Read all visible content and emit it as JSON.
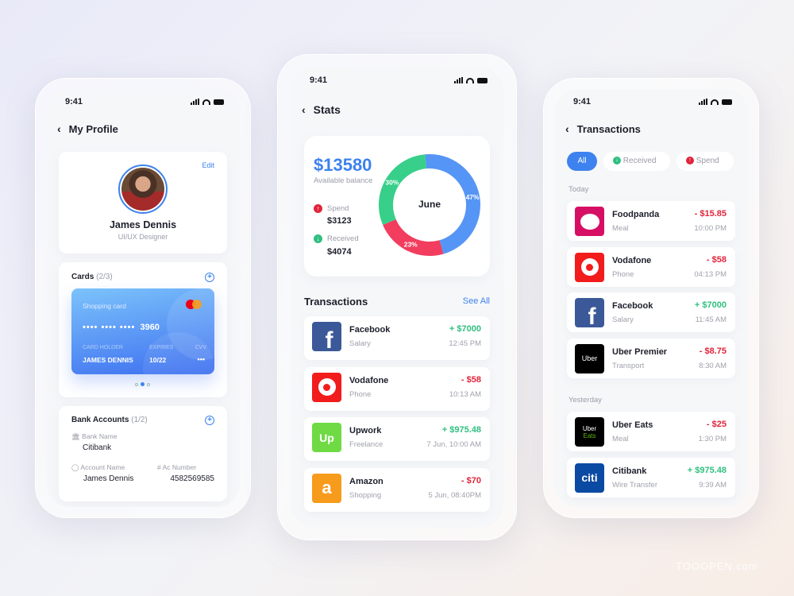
{
  "status_time": "9:41",
  "profile": {
    "title": "My Profile",
    "edit": "Edit",
    "name": "James Dennis",
    "role": "UI/UX Designer",
    "cards_title": "Cards",
    "cards_count": "(2/3)",
    "card": {
      "label": "Shopping card",
      "masked": "•••• •••• ••••",
      "last4": "3960",
      "holder_label": "CARD HOLDER",
      "holder": "JAMES DENNIS",
      "expires_label": "EXPIRES",
      "expires": "10/22",
      "cvv_label": "CVV",
      "cvv": "•••"
    },
    "bank_title": "Bank Accounts",
    "bank_count": "(1/2)",
    "bank_name_label": "Bank Name",
    "bank_name": "Citibank",
    "account_name_label": "Account Name",
    "account_name": "James Dennis",
    "ac_number_label": "Ac Number",
    "ac_number": "4582569585"
  },
  "stats": {
    "title": "Stats",
    "balance": "$13580",
    "balance_label": "Available balance",
    "spend_label": "Spend",
    "spend": "$3123",
    "received_label": "Received",
    "received": "$4074",
    "month": "June",
    "chart_data": {
      "type": "pie",
      "values": [
        47,
        23,
        30
      ],
      "labels": [
        "47%",
        "23%",
        "30%"
      ],
      "colors": [
        "#5595f5",
        "#f23d5e",
        "#37cf8a"
      ]
    },
    "tx_title": "Transactions",
    "see_all": "See All",
    "transactions": [
      {
        "name": "Facebook",
        "category": "Salary",
        "amount": "+ $7000",
        "time": "12:45 PM",
        "type": "pos",
        "logo": "f",
        "bg": "#3b5998"
      },
      {
        "name": "Vodafone",
        "category": "Phone",
        "amount": "- $58",
        "time": "10:13 AM",
        "type": "neg",
        "logo": "vodafone",
        "bg": "#f21c1c"
      },
      {
        "name": "Upwork",
        "category": "Freelance",
        "amount": "+ $975.48",
        "time": "7 Jun, 10:00 AM",
        "type": "pos",
        "logo": "Up",
        "bg": "#6fda44"
      },
      {
        "name": "Amazon",
        "category": "Shopping",
        "amount": "- $70",
        "time": "5 Jun, 08:40PM",
        "type": "neg",
        "logo": "a",
        "bg": "#f79b1c"
      }
    ]
  },
  "transactions": {
    "title": "Transactions",
    "filters": [
      "All",
      "Received",
      "Spend"
    ],
    "today": "Today",
    "yesterday": "Yesterday",
    "today_items": [
      {
        "name": "Foodpanda",
        "category": "Meal",
        "amount": "- $15.85",
        "time": "10:00 PM",
        "type": "neg",
        "logo": "panda",
        "bg": "#d70f64"
      },
      {
        "name": "Vodafone",
        "category": "Phone",
        "amount": "- $58",
        "time": "04:13 PM",
        "type": "neg",
        "logo": "vodafone",
        "bg": "#f21c1c"
      },
      {
        "name": "Facebook",
        "category": "Salary",
        "amount": "+ $7000",
        "time": "11:45 AM",
        "type": "pos",
        "logo": "f",
        "bg": "#3b5998"
      },
      {
        "name": "Uber Premier",
        "category": "Transport",
        "amount": "- $8.75",
        "time": "8:30 AM",
        "type": "neg",
        "logo": "Uber",
        "bg": "#000000"
      }
    ],
    "yesterday_items": [
      {
        "name": "Uber Eats",
        "category": "Meal",
        "amount": "- $25",
        "time": "1:30 PM",
        "type": "neg",
        "logo": "Uber Eats",
        "bg": "#000000"
      },
      {
        "name": "Citibank",
        "category": "Wire Transfer",
        "amount": "+ $975.48",
        "time": "9:39 AM",
        "type": "pos",
        "logo": "citi",
        "bg": "#0b4aa2"
      }
    ]
  },
  "watermark": "TOOOPEN.com"
}
